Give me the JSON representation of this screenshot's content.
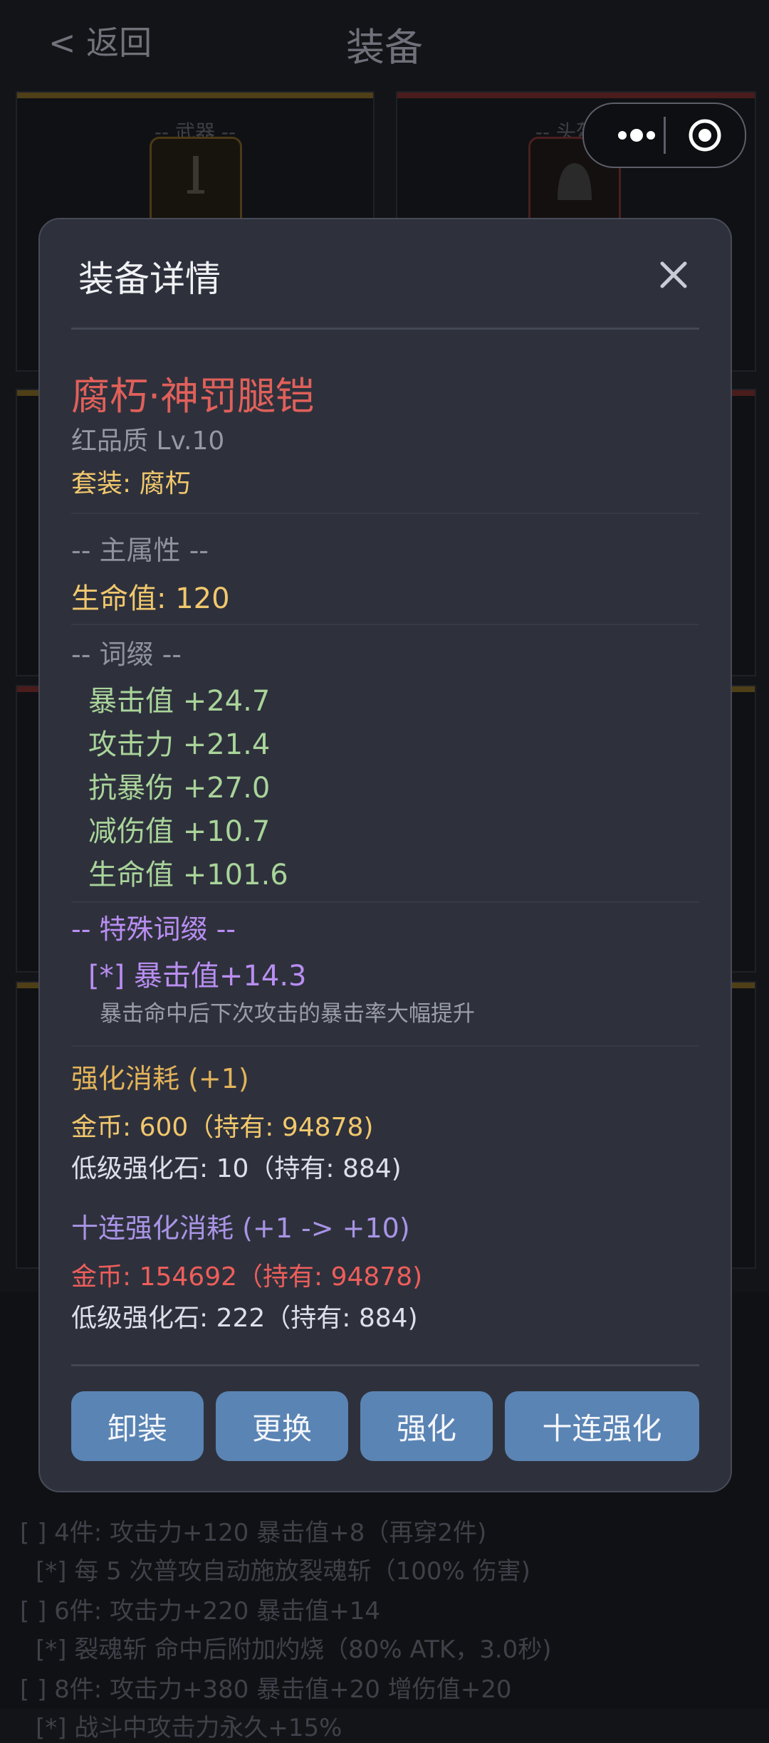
{
  "nav": {
    "back_label": "< 返回",
    "title": "装备"
  },
  "slots": [
    {
      "label": "-- 武器 --"
    },
    {
      "label": "-- 头盔 --"
    }
  ],
  "background_set": {
    "line_1": "[ ] 4件: 攻击力+120  暴击值+8（再穿2件)",
    "line_2": "[*] 每 5 次普攻自动施放裂魂斩（100% 伤害)",
    "line_3": "[ ] 6件: 攻击力+220  暴击值+14",
    "line_4": "[*] 裂魂斩 命中后附加灼烧（80% ATK，3.0秒)",
    "line_5": "[ ] 8件: 攻击力+380  暴击值+20  增伤值+20",
    "line_6": "[*] 战斗中攻击力永久+15%"
  },
  "modal": {
    "title": "装备详情",
    "item_name": "腐朽·神罚腿铠",
    "quality_level": "红品质  Lv.10",
    "set_label": "套装: 腐朽",
    "main_attr_header": "-- 主属性 --",
    "main_attr": "生命值: 120",
    "affix_header": "-- 词缀 --",
    "affixes": [
      "暴击值 +24.7",
      "攻击力 +21.4",
      "抗暴伤 +27.0",
      "减伤值 +10.7",
      "生命值 +101.6"
    ],
    "special_header": "-- 特殊词缀 --",
    "special_affix": "[*] 暴击值+14.3",
    "special_desc": "暴击命中后下次攻击的暴击率大幅提升",
    "enhance": {
      "header": "强化消耗 (+1)",
      "gold": "金币: 600（持有: 94878)",
      "stone": "低级强化石: 10（持有: 884)"
    },
    "ten_enhance": {
      "header": "十连强化消耗 (+1 -> +10)",
      "gold": "金币: 154692（持有: 94878)",
      "stone": "低级强化石: 222（持有: 884)"
    },
    "buttons": {
      "unequip": "卸装",
      "replace": "更换",
      "enhance": "强化",
      "ten_enhance": "十连强化"
    }
  },
  "colors": {
    "accent_button": "#5a84b4",
    "item_name_red": "#e0605a",
    "gold_yellow": "#f2c86d",
    "affix_green": "#a9d49a",
    "special_purple": "#b98ef2",
    "insufficient_red": "#ee5e5b"
  },
  "icons": [
    "more-dots-icon",
    "target-icon",
    "close-icon",
    "sword-icon",
    "helmet-icon"
  ]
}
